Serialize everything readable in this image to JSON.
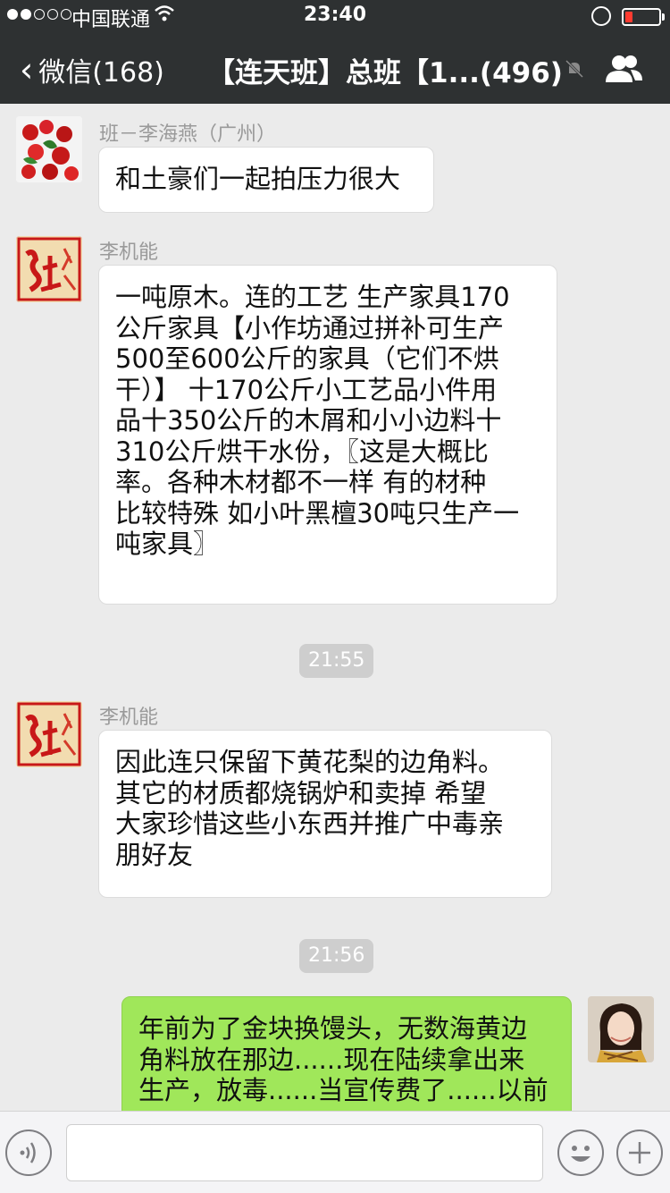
{
  "status_bar": {
    "carrier": "中国联通",
    "time": "23:40",
    "signal_bars_filled": 2,
    "signal_bars_total": 5,
    "battery_level": 0.15,
    "battery_color": "#ff3b30"
  },
  "nav": {
    "back_label": "微信(168)",
    "title": "【连天班】总班【1...(496)",
    "icons": [
      "chevron-left-icon",
      "mute-bell-icon",
      "group-people-icon"
    ]
  },
  "messages": [
    {
      "sender": "班－李海燕（广州）",
      "avatar": "berries-photo",
      "lines": [
        "和土豪们一起拍压力很大"
      ]
    },
    {
      "sender": "李机能",
      "avatar": "red-calligraphy-logo",
      "lines": [
        "一吨原木。连的工艺 生产家具170",
        "公斤家具【小作坊通过拼补可生产",
        "500至600公斤的家具（它们不烘",
        "干）】 十170公斤小工艺品小件用",
        "品十350公斤的木屑和小小边料十",
        "310公斤烘干水份，〖这是大概比",
        "率。各种木材都不一样 有的材种",
        "比较特殊 如小叶黑檀30吨只生产一",
        "吨家具〗"
      ]
    },
    {
      "time": "21:55"
    },
    {
      "sender": "李机能",
      "avatar": "red-calligraphy-logo",
      "lines": [
        "因此连只保留下黄花梨的边角料。",
        "其它的材质都烧锅炉和卖掉  希望",
        "大家珍惜这些小东西并推广中毒亲",
        "朋好友"
      ]
    },
    {
      "time": "21:56"
    },
    {
      "sender": "",
      "avatar": "woman-photo",
      "self": true,
      "lines": [
        "年前为了金块换馒头，无数海黄边",
        "角料放在那边......现在陆续拿出来",
        "生产，放毒......当宣传费了......以前"
      ]
    }
  ],
  "input_bar": {
    "icons": [
      "voice-icon",
      "emoji-icon",
      "plus-icon"
    ]
  },
  "colors": {
    "header": "#2e3132",
    "background": "#ebebeb",
    "self_bubble": "#a0e75a",
    "other_bubble": "#ffffff"
  }
}
